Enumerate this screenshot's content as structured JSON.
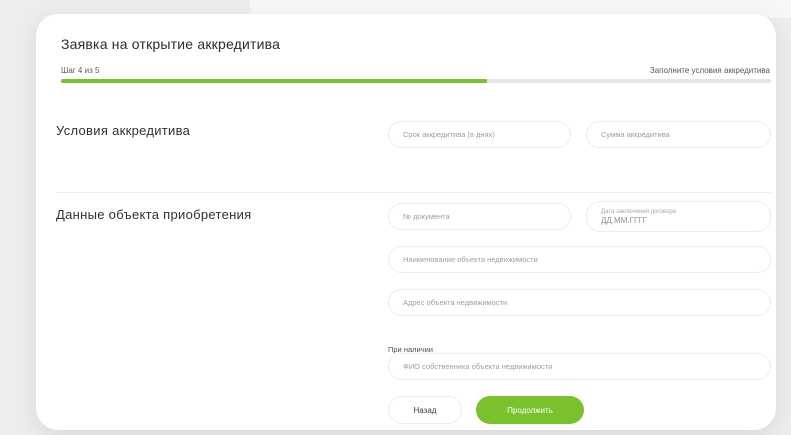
{
  "form": {
    "title": "Заявка на открытие аккредитива",
    "step_counter": "Шаг 4 из 5",
    "step_hint": "Заполните условия аккредитива",
    "progress": 0.6
  },
  "sections": {
    "terms": {
      "title": "Условия аккредитива",
      "term_placeholder": "Срок аккредитива (в днях)",
      "amount_placeholder": "Сумма аккредитива"
    },
    "object": {
      "title": "Данные объекта приобретения",
      "doc_number_placeholder": "№ документа",
      "contract_date_label": "Дата заключения договора",
      "contract_date_hint": "ДД.ММ.ГГГГ",
      "object_name_placeholder": "Наименование объекта недвижимости",
      "object_address_placeholder": "Адрес объекта недвижимости",
      "optional_label": "При наличии",
      "owner_name_placeholder": "ФИО собственника объекта недвижимости"
    }
  },
  "buttons": {
    "back_label": "Назад",
    "next_label": "Продолжить"
  },
  "colors": {
    "accent": "#79c22d",
    "page_background": "#ebedef",
    "card_background": "#ffffff"
  }
}
